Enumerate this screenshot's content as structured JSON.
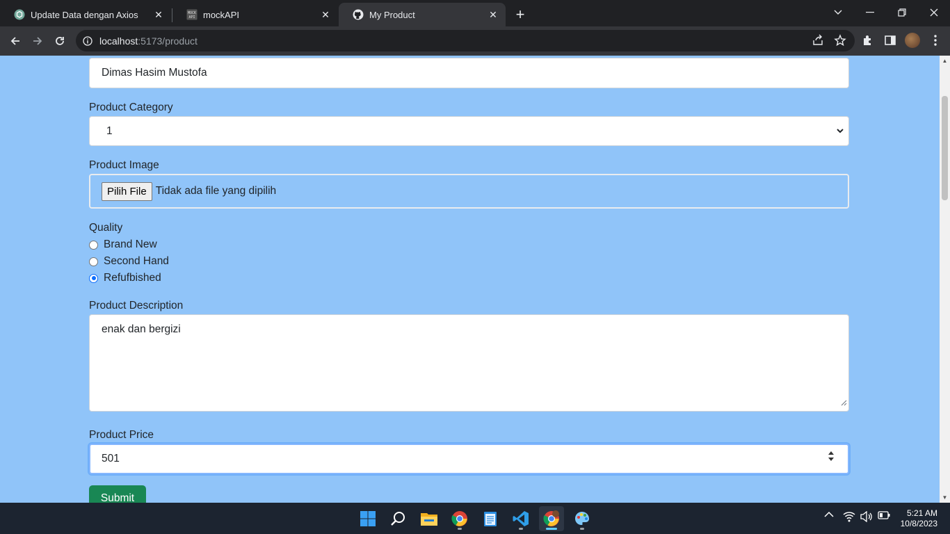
{
  "browser": {
    "tabs": [
      {
        "title": "Update Data dengan Axios",
        "icon": "chatgpt-icon",
        "active": false
      },
      {
        "title": "mockAPI",
        "icon": "mockapi-icon",
        "active": false
      },
      {
        "title": "My Product",
        "icon": "github-icon",
        "active": true
      }
    ],
    "url_host": "localhost",
    "url_rest": ":5173/product"
  },
  "form": {
    "name_value": "Dimas Hasim Mustofa",
    "category_label": "Product Category",
    "category_value": "1",
    "image_label": "Product Image",
    "file_button": "Pilih File",
    "file_status": "Tidak ada file yang dipilih",
    "quality_label": "Quality",
    "quality_options": [
      {
        "label": "Brand New",
        "checked": false
      },
      {
        "label": "Second Hand",
        "checked": false
      },
      {
        "label": "Refufbished",
        "checked": true
      }
    ],
    "description_label": "Product Description",
    "description_value": "enak dan bergizi",
    "price_label": "Product Price",
    "price_value": "501",
    "submit_label": "Submit"
  },
  "colors": {
    "page_bg": "#90c4f9",
    "submit_bg": "#198754",
    "focus_border": "#86b7fe",
    "radio_checked": "#0d6efd"
  },
  "taskbar": {
    "apps": [
      "start-icon",
      "search-icon",
      "file-explorer-icon",
      "chrome-icon",
      "notepad-icon",
      "vscode-icon",
      "chrome-profile-icon",
      "paint-icon"
    ],
    "time": "5:21 AM",
    "date": "10/8/2023"
  }
}
